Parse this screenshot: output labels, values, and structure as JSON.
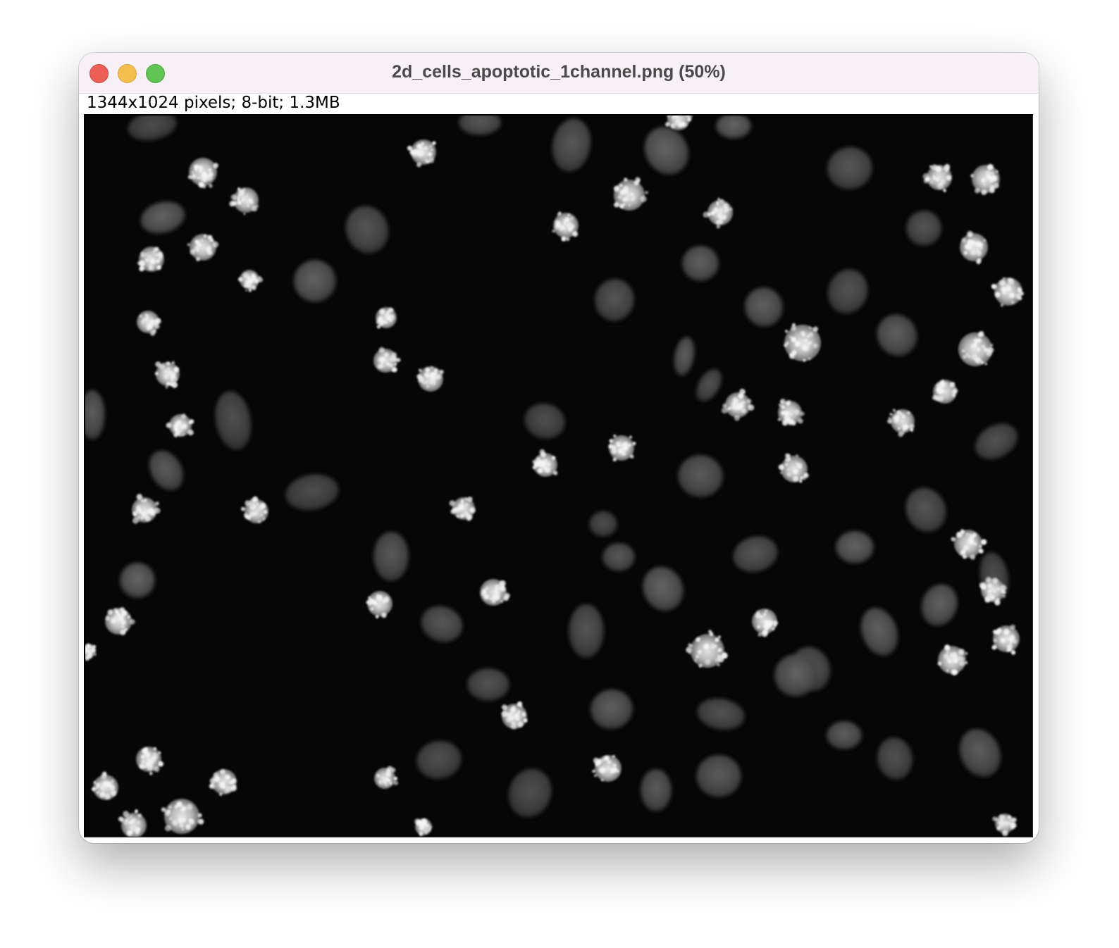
{
  "window": {
    "title": "2d_cells_apoptotic_1channel.png (50%)",
    "info": "1344x1024 pixels; 8-bit; 1.3MB",
    "zoom_percent": 50
  },
  "image": {
    "description_icon": "microscopy-image",
    "background_color": "#060606",
    "nucleus_color": "#5a5a5a",
    "apoptotic_color": "#e6e6e6"
  }
}
